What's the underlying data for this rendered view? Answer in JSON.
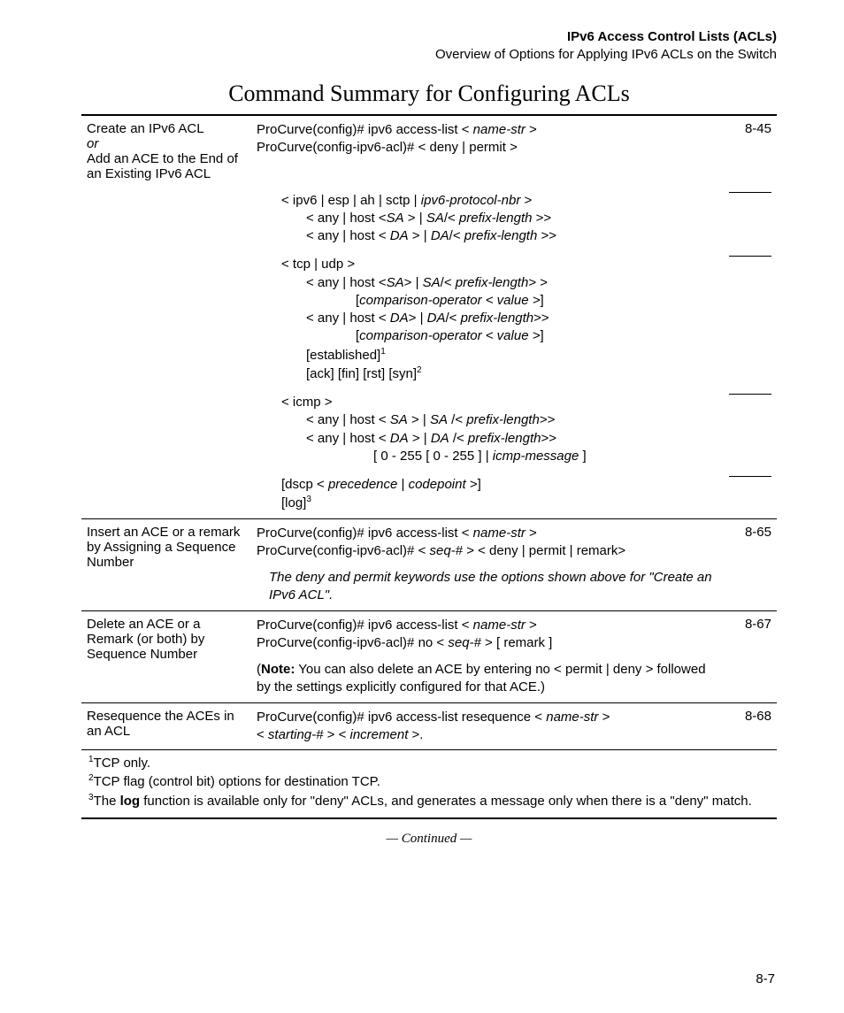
{
  "header": {
    "title": "IPv6 Access Control Lists (ACLs)",
    "subtitle": "Overview of Options for Applying IPv6 ACLs on the Switch"
  },
  "section_title": "Command Summary for Configuring ACLs",
  "rows": {
    "r1": {
      "label_a": "Create an IPv6 ACL",
      "label_or": "or",
      "label_b": "Add an ACE to the End of an Existing IPv6 ACL",
      "cmd_line": "ProCurve(config)# ipv6 access-list <",
      "cmd_name": " name-str",
      "cmd_tail": " >",
      "sub_line": "ProCurve(config-ipv6-acl)# < deny | permit >",
      "page": "8-45",
      "blk1_l1a": "< ipv6 | esp | ah | sctp |",
      "blk1_l1b": " ipv6-protocol-nbr",
      "blk1_l1c": " >",
      "blk1_l2a": "< any | host <",
      "blk1_sa": "SA",
      "blk1_l2b": " > |",
      "blk1_l2c": "/<",
      "blk1_pl": " prefix-length",
      "blk1_l2d": " >>",
      "blk1_l3a": "< any | host <",
      "blk1_da": " DA",
      "blk1_l3b": " > |",
      "blk1_l3c": "/<",
      "blk2_l1": "< tcp | udp >",
      "blk2_l2a": "< any | host <",
      "blk2_l2b": "> |",
      "blk2_l2c": "/<",
      "blk2_l2d": "> >",
      "blk2_comp": "comparison-operator",
      "blk2_val": "< value >",
      "blk2_l4a": "< any | host <",
      "blk2_l4b": "> |",
      "blk2_l4c": "/<",
      "blk2_l4d": ">>",
      "blk2_est": "[established]",
      "blk2_sup1": "1",
      "blk2_flags": "[ack] [fin] [rst] [syn]",
      "blk2_sup2": "2",
      "blk3_l1": "< icmp >",
      "blk3_l2a": "< any | host <",
      "blk3_l2b": "> |",
      "blk3_slash": " /<",
      "blk3_l2c": ">>",
      "blk3_l3a": "< any | host <",
      "blk3_l3b": "> |",
      "blk3_l3c": ">>",
      "blk3_l4a": "[ 0 - 255  [ 0 - 255 ] |",
      "blk3_icmp": " icmp-message",
      "blk3_l4b": "  ]",
      "blk4_l1a": "[dscp <",
      "blk4_prec": " precedence",
      "blk4_pipe": " |",
      "blk4_code": " codepoint",
      "blk4_l1b": " >]",
      "blk4_l2": "[log]",
      "blk4_sup3": "3"
    },
    "r2": {
      "label": "Insert an ACE or a remark by Assigning a Sequence Number",
      "cmd1": "ProCurve(config)# ipv6 access-list <",
      "name": " name-str",
      "cmd1b": " >",
      "cmd2": "ProCurve(config-ipv6-acl)#  <",
      "seq": " seq-#",
      "cmd2b": " > < deny | permit | remark>",
      "page": "8-65",
      "note": "The deny and permit keywords use the options shown above for \"Create an IPv6 ACL\"."
    },
    "r3": {
      "label": "Delete an ACE or a Remark (or both) by Sequence Number",
      "cmd1": "ProCurve(config)# ipv6 access-list <",
      "name": " name-str",
      "cmd1b": " >",
      "cmd2": "ProCurve(config-ipv6-acl)# no <",
      "seq": " seq-#",
      "cmd2b": " > [ remark ]",
      "page": "8-67",
      "note_pre": "(",
      "note_bold": "Note:",
      "note_body": " You can also delete an ACE by entering no < permit | deny > followed by the settings explicitly configured for that ACE.)"
    },
    "r4": {
      "label": "Resequence the ACEs in an ACL",
      "cmd1": "ProCurve(config)# ipv6 access-list resequence <",
      "name": " name-str",
      "cmd1b": " >",
      "cmd2a": "<",
      "start": " starting-#",
      "cmd2b": " > <",
      "inc": " increment",
      "cmd2c": " >.",
      "page": "8-68"
    }
  },
  "footnotes": {
    "f1": "TCP only.",
    "f2": "TCP flag (control bit) options for destination TCP.",
    "f3a": "The ",
    "f3b": "log",
    "f3c": " function is available only for \"deny\" ACLs, and generates a message only when there is a \"deny\" match."
  },
  "continued": "— Continued —",
  "page_number": "8-7"
}
